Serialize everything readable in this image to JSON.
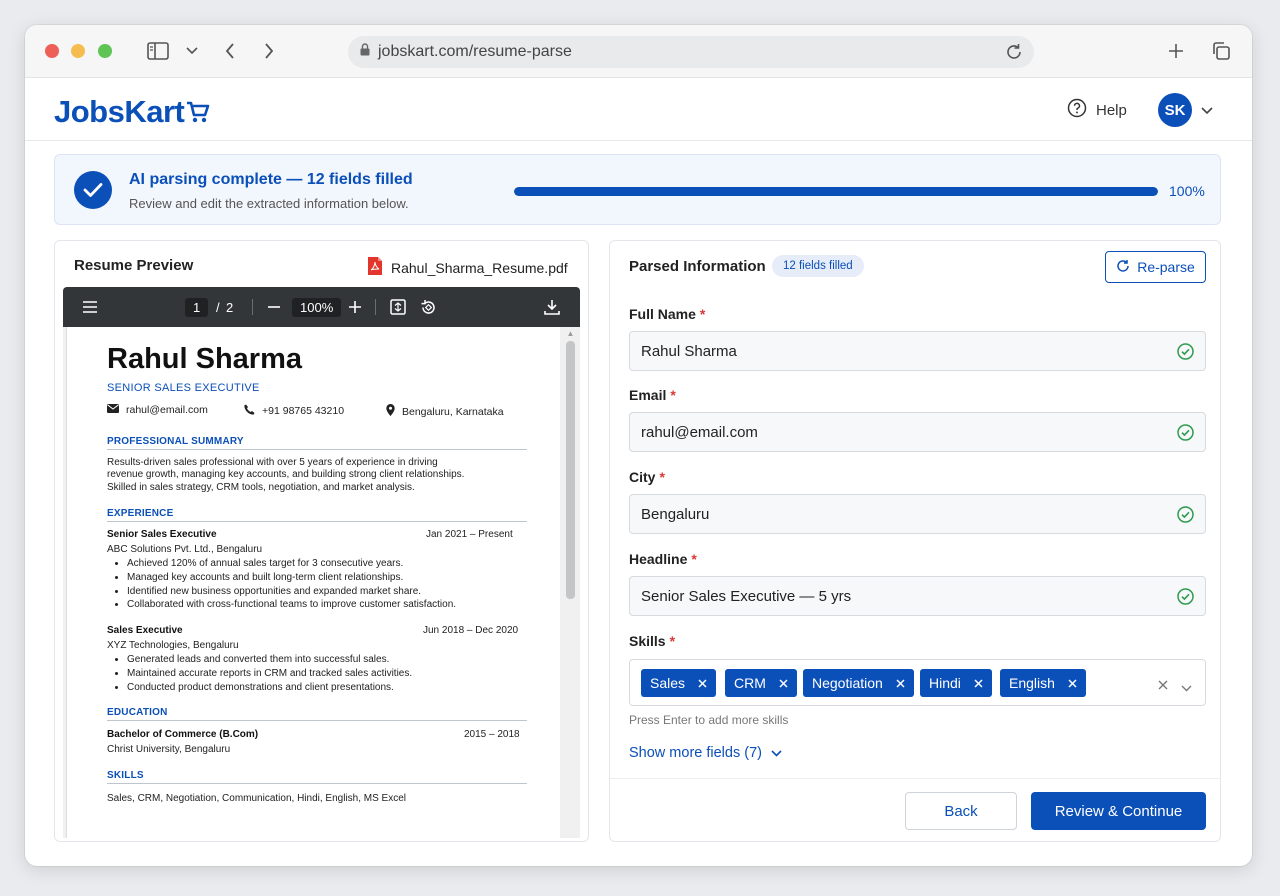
{
  "browser": {
    "url": "jobskart.com/resume-parse"
  },
  "header": {
    "logo": "JobsKart",
    "help_label": "Help",
    "avatar_initials": "SK"
  },
  "banner": {
    "title": "AI parsing complete — 12 fields filled",
    "subtitle": "Review and edit the extracted information below.",
    "progress_fraction": 1.0,
    "progress_label": "100%"
  },
  "preview": {
    "title": "Resume Preview",
    "file_name": "Rahul_Sharma_Resume.pdf",
    "toolbar": {
      "page_current": "1",
      "page_separator": "/",
      "page_total": "2",
      "zoom": "100%"
    },
    "resume": {
      "name": "Rahul Sharma",
      "headline": "SENIOR SALES EXECUTIVE",
      "email": "rahul@email.com",
      "phone": "+91 98765 43210",
      "location": "Bengaluru, Karnataka",
      "summary_heading": "PROFESSIONAL SUMMARY",
      "summary_lines": [
        "Results-driven sales professional with over 5 years of experience in driving",
        "revenue growth, managing key accounts, and building strong client relationships.",
        "Skilled in sales strategy, CRM tools, negotiation, and market analysis."
      ],
      "experience_heading": "EXPERIENCE",
      "jobs": [
        {
          "title": "Senior Sales Executive",
          "dates": "Jan 2021 – Present",
          "company": "ABC Solutions Pvt. Ltd., Bengaluru",
          "bullets": [
            "Achieved 120% of annual sales target for 3 consecutive years.",
            "Managed key accounts and built long-term client relationships.",
            "Identified new business opportunities and expanded market share.",
            "Collaborated with cross-functional teams to improve customer satisfaction."
          ]
        },
        {
          "title": "Sales Executive",
          "dates": "Jun 2018 – Dec 2020",
          "company": "XYZ Technologies, Bengaluru",
          "bullets": [
            "Generated leads and converted them into successful sales.",
            "Maintained accurate reports in CRM and tracked sales activities.",
            "Conducted product demonstrations and client presentations."
          ]
        }
      ],
      "education_heading": "EDUCATION",
      "degree": "Bachelor of Commerce (B.Com)",
      "degree_dates": "2015 – 2018",
      "university": "Christ University, Bengaluru",
      "skills_heading": "SKILLS",
      "skills_line": "Sales, CRM, Negotiation, Communication, Hindi, English, MS Excel"
    }
  },
  "form": {
    "title": "Parsed Information",
    "badge": "12 fields filled",
    "reparse_label": "Re-parse",
    "required_mark": "*",
    "fields": [
      {
        "label": "Full Name",
        "value": "Rahul Sharma"
      },
      {
        "label": "Email",
        "value": "rahul@email.com"
      },
      {
        "label": "City",
        "value": "Bengaluru"
      },
      {
        "label": "Headline",
        "value": "Senior Sales Executive — 5 yrs"
      }
    ],
    "skills_label": "Skills",
    "skills": [
      "Sales",
      "CRM",
      "Negotiation",
      "Hindi",
      "English"
    ],
    "skills_hint": "Press Enter to add more skills",
    "show_more": "Show more fields (7)",
    "back_label": "Back",
    "continue_label": "Review & Continue"
  },
  "colors": {
    "brand": "#0b4fb8",
    "success": "#2e9b4e",
    "required": "#d93838",
    "pdf_icon": "#e2352b"
  },
  "icons": [
    "sidebar-toggle-icon",
    "chevron-down-icon",
    "back-arrow-icon",
    "forward-arrow-icon",
    "lock-icon",
    "reload-icon",
    "new-tab-icon",
    "tabs-overview-icon",
    "cart-icon",
    "help-icon",
    "checkmark-icon",
    "pdf-file-icon",
    "menu-icon",
    "zoom-out-icon",
    "zoom-in-icon",
    "fit-page-icon",
    "rotate-icon",
    "download-icon",
    "mail-icon",
    "phone-icon",
    "location-pin-icon",
    "check-circle-icon",
    "refresh-icon",
    "remove-chip-icon",
    "clear-icon"
  ]
}
